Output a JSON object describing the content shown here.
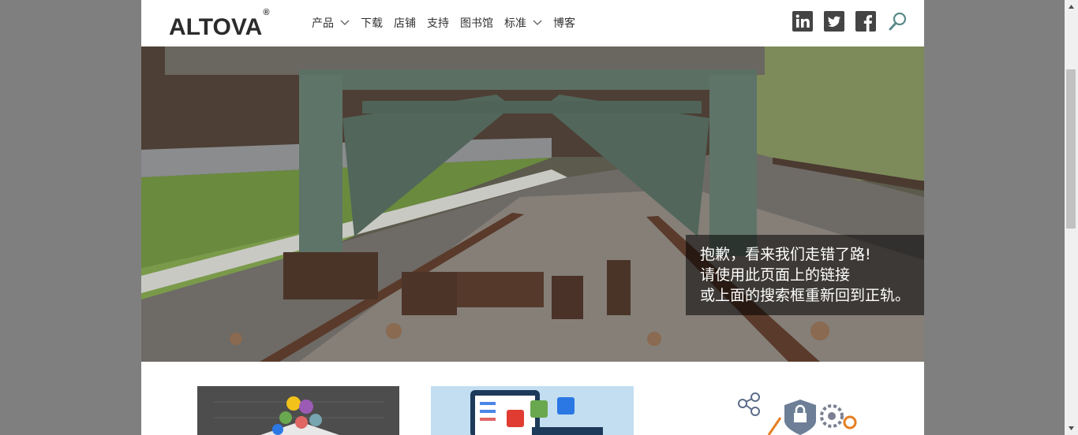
{
  "header": {
    "logo_text": "ALTOVA",
    "logo_mark": "®",
    "nav": [
      {
        "label": "产品",
        "has_dropdown": true
      },
      {
        "label": "下载",
        "has_dropdown": false
      },
      {
        "label": "店铺",
        "has_dropdown": false
      },
      {
        "label": "支持",
        "has_dropdown": false
      },
      {
        "label": "图书馆",
        "has_dropdown": false
      },
      {
        "label": "标准",
        "has_dropdown": true
      },
      {
        "label": "博客",
        "has_dropdown": false
      }
    ],
    "social_icons": [
      "linkedin-icon",
      "twitter-icon",
      "facebook-icon",
      "search-icon"
    ]
  },
  "hero": {
    "caption_lines": [
      "抱歉，看来我们走错了路!",
      "请使用此页面上的链接",
      "或上面的搜索框重新回到正轨。"
    ]
  },
  "colors": {
    "page_bg": "#7f7f7f",
    "text": "#333333",
    "icon": "#444444",
    "search_icon": "#5a8a8a"
  }
}
